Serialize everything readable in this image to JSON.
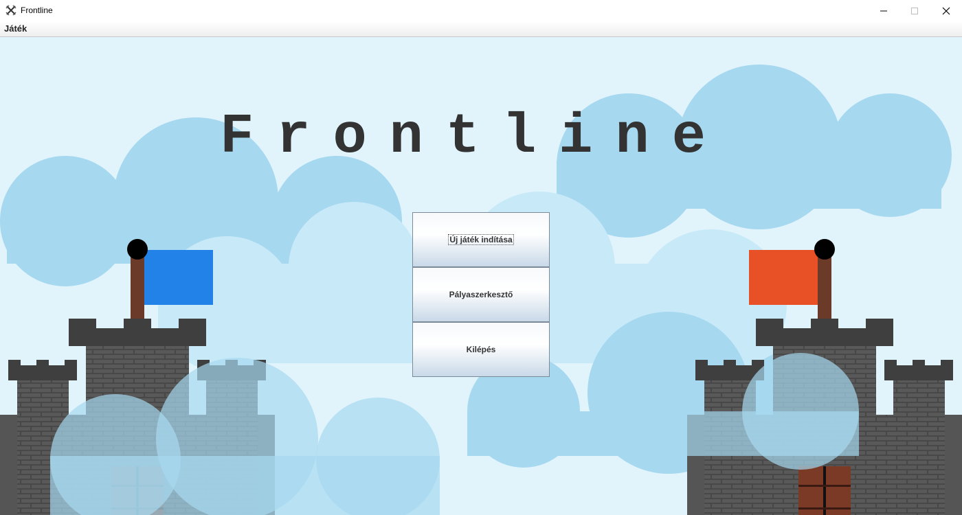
{
  "window": {
    "title": "Frontline",
    "icon": "crossed-swords-icon",
    "controls": [
      "minimize-icon",
      "maximize-icon",
      "close-icon"
    ]
  },
  "menubar": {
    "items": [
      {
        "label": "Játék"
      }
    ]
  },
  "game": {
    "title": "Frontline",
    "buttons": [
      {
        "label": "Új játék indítása",
        "focused": true
      },
      {
        "label": "Pályaszerkesztő",
        "focused": false
      },
      {
        "label": "Kilépés",
        "focused": false
      }
    ]
  },
  "colors": {
    "sky": "#e1f4fc",
    "cloud": "#a6d8f0",
    "castle_stone": "#444444",
    "flag_left": "#2382e8",
    "flag_right": "#e85025",
    "flag_pole": "#6b3a28",
    "door": "#7a3a25"
  }
}
